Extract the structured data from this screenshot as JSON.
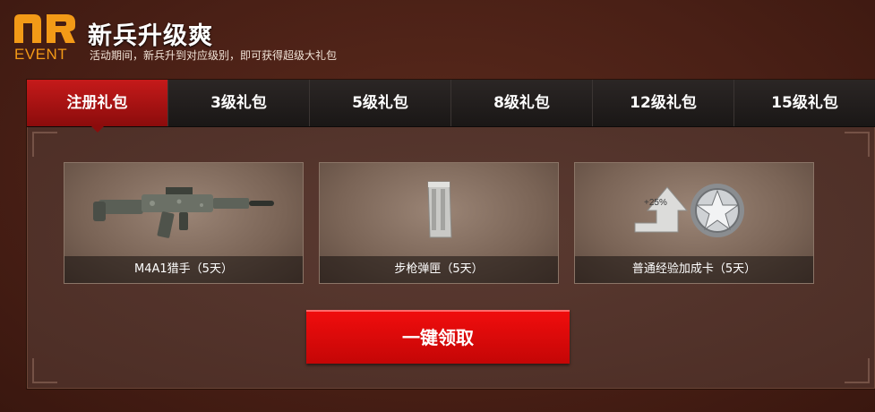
{
  "header": {
    "logo_text": "EVENT",
    "title": "新兵升级爽",
    "subtitle": "活动期间，新兵升到对应级别，即可获得超级大礼包"
  },
  "tabs": [
    {
      "label": "注册礼包",
      "active": true
    },
    {
      "label": "3级礼包",
      "active": false
    },
    {
      "label": "5级礼包",
      "active": false
    },
    {
      "label": "8级礼包",
      "active": false
    },
    {
      "label": "12级礼包",
      "active": false
    },
    {
      "label": "15级礼包",
      "active": false
    }
  ],
  "rewards": [
    {
      "name": "M4A1猎手（5天）",
      "icon": "rifle-icon"
    },
    {
      "name": "步枪弹匣（5天）",
      "icon": "magazine-icon"
    },
    {
      "name": "普通经验加成卡（5天）",
      "icon": "exp-boost-icon",
      "badge": "+25%"
    }
  ],
  "claim_button": "一键领取",
  "colors": {
    "accent": "#d10b0b",
    "logo": "#f39a17",
    "background": "#4a2016"
  }
}
